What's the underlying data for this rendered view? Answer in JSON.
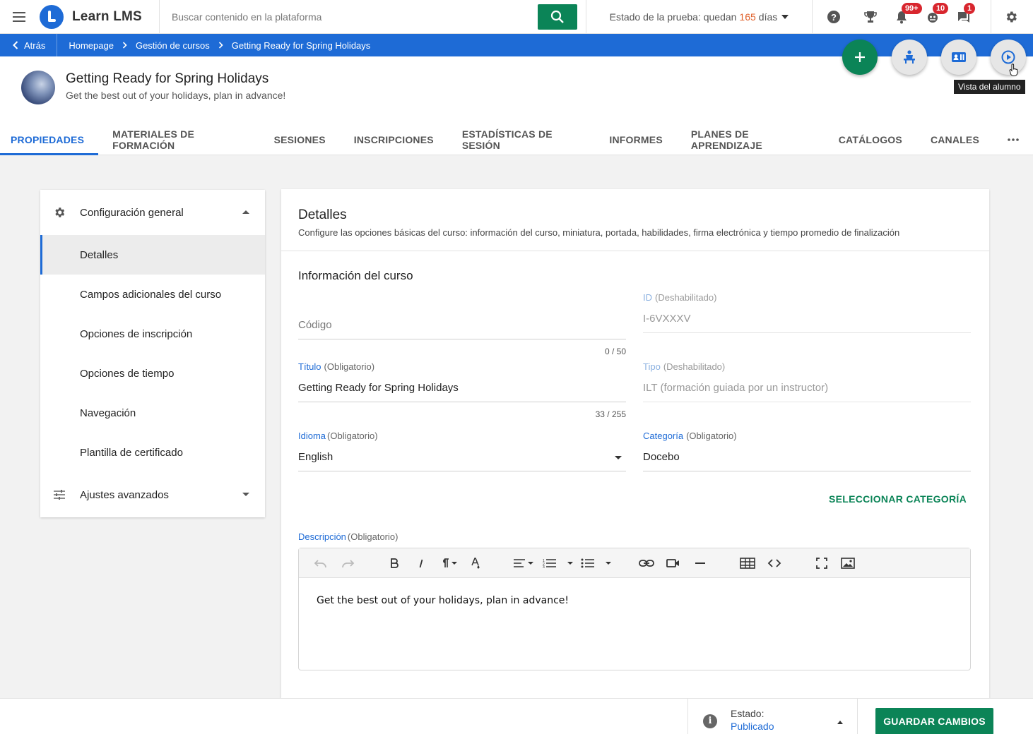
{
  "app": {
    "logo_text": "Learn LMS",
    "brand_color": "#1e6bd6",
    "accent_color": "#0b8457"
  },
  "topbar": {
    "search_placeholder": "Buscar contenido en la plataforma",
    "trial_prefix": "Estado de la prueba: quedan",
    "trial_days": "165",
    "trial_suffix": "días",
    "icons": [
      {
        "name": "help-icon"
      },
      {
        "name": "trophy-icon"
      },
      {
        "name": "notifications-icon",
        "badge": "99+"
      },
      {
        "name": "activity-icon",
        "badge": "10"
      },
      {
        "name": "messages-icon",
        "badge": "1"
      },
      {
        "name": "settings-icon"
      }
    ]
  },
  "breadcrumb": {
    "back_label": "Atrás",
    "items": [
      "Homepage",
      "Gestión de cursos",
      "Getting Ready for Spring Holidays"
    ]
  },
  "actions": {
    "tooltip": "Vista del alumno"
  },
  "course": {
    "title": "Getting Ready for Spring Holidays",
    "subtitle": "Get the best out of your holidays, plan in advance!"
  },
  "tabs": [
    "PROPIEDADES",
    "MATERIALES DE FORMACIÓN",
    "SESIONES",
    "INSCRIPCIONES",
    "ESTADÍSTICAS DE SESIÓN",
    "INFORMES",
    "PLANES DE APRENDIZAJE",
    "CATÁLOGOS",
    "CANALES"
  ],
  "sidemenu": {
    "general_group": "Configuración general",
    "items": [
      "Detalles",
      "Campos adicionales del curso",
      "Opciones de inscripción",
      "Opciones de tiempo",
      "Navegación",
      "Plantilla de certificado"
    ],
    "advanced_group": "Ajustes avanzados"
  },
  "details": {
    "title": "Detalles",
    "description": "Configure las opciones básicas del curso: información del curso, miniatura, portada, habilidades, firma electrónica y tiempo promedio de finalización",
    "section_title": "Información del curso",
    "code": {
      "placeholder": "Código",
      "counter": "0 / 50"
    },
    "id": {
      "label": "ID",
      "qualifier": "(Deshabilitado)",
      "value": "I-6VXXXV"
    },
    "title_field": {
      "label": "Título",
      "qualifier": "(Obligatorio)",
      "value": "Getting Ready for Spring Holidays",
      "counter": "33 / 255"
    },
    "type": {
      "label": "Tipo",
      "qualifier": "(Deshabilitado)",
      "value": "ILT (formación guiada por un instructor)"
    },
    "language": {
      "label": "Idioma",
      "qualifier": "(Obligatorio)",
      "value": "English"
    },
    "category": {
      "label": "Categoría",
      "qualifier": "(Obligatorio)",
      "value": "Docebo"
    },
    "select_category": "SELECCIONAR CATEGORÍA",
    "description_field": {
      "label": "Descripción",
      "qualifier": "(Obligatorio)",
      "value": "Get the best out of your holidays, plan in advance!"
    }
  },
  "footer": {
    "status_label": "Estado:",
    "status_value": "Publicado",
    "save_label": "GUARDAR CAMBIOS"
  }
}
